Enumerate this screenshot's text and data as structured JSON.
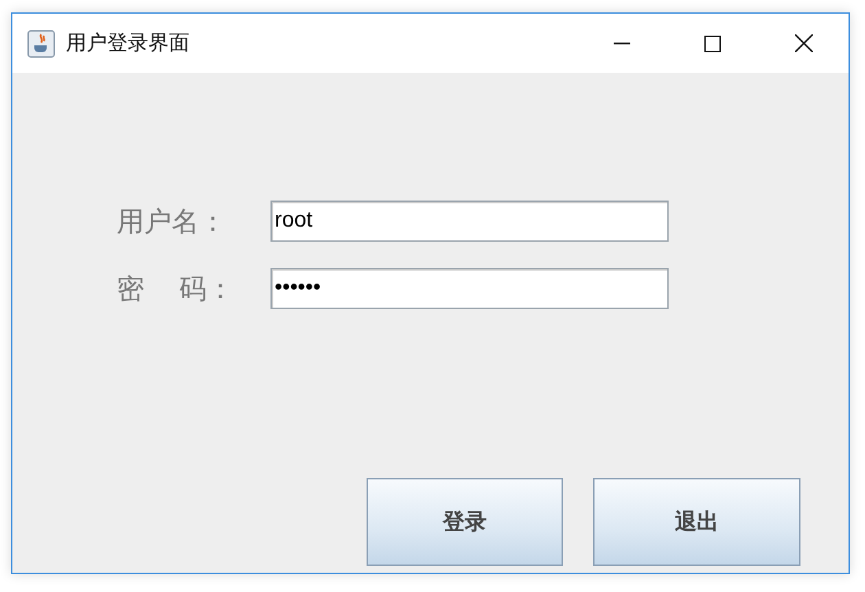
{
  "window": {
    "title": "用户登录界面",
    "controls": [
      {
        "kind": "minimize"
      },
      {
        "kind": "maximize"
      },
      {
        "kind": "close"
      }
    ]
  },
  "form": {
    "fields": [
      {
        "label": "用户名：",
        "value": "root"
      },
      {
        "label": "密    码：",
        "value": "••••••"
      }
    ]
  },
  "buttons": [
    "登录",
    "退出"
  ]
}
